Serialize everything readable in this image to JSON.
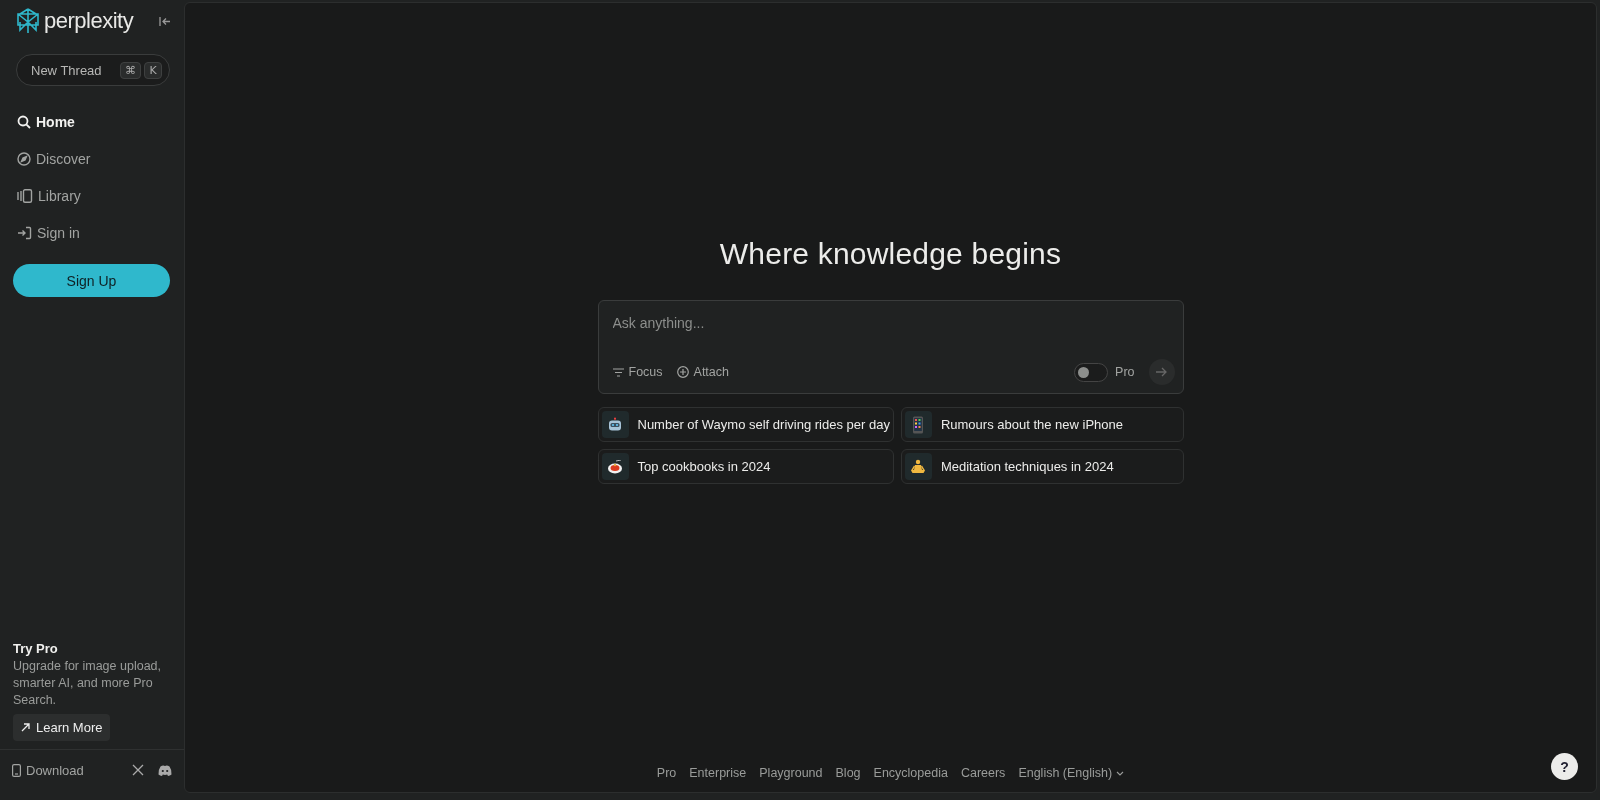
{
  "sidebar": {
    "logo": "perplexity",
    "new_thread": {
      "label": "New Thread",
      "keys": [
        "⌘",
        "K"
      ]
    },
    "nav": [
      {
        "label": "Home",
        "selected": true
      },
      {
        "label": "Discover",
        "selected": false
      },
      {
        "label": "Library",
        "selected": false
      },
      {
        "label": "Sign in",
        "selected": false
      }
    ],
    "sign_up": "Sign Up",
    "promo": {
      "title": "Try Pro",
      "text": "Upgrade for image upload, smarter AI, and more Pro Search.",
      "button": "Learn More"
    },
    "download": "Download"
  },
  "main": {
    "heading": "Where knowledge begins",
    "search": {
      "placeholder": "Ask anything...",
      "focus": "Focus",
      "attach": "Attach",
      "pro_label": "Pro",
      "pro_on": false
    },
    "suggestions": [
      {
        "text": "Number of Waymo self driving rides per day"
      },
      {
        "text": "Rumours about the new iPhone"
      },
      {
        "text": "Top cookbooks in 2024"
      },
      {
        "text": "Meditation techniques in 2024"
      }
    ],
    "footer_links": [
      "Pro",
      "Enterprise",
      "Playground",
      "Blog",
      "Encyclopedia",
      "Careers"
    ],
    "language": "English (English)",
    "help": "?"
  }
}
